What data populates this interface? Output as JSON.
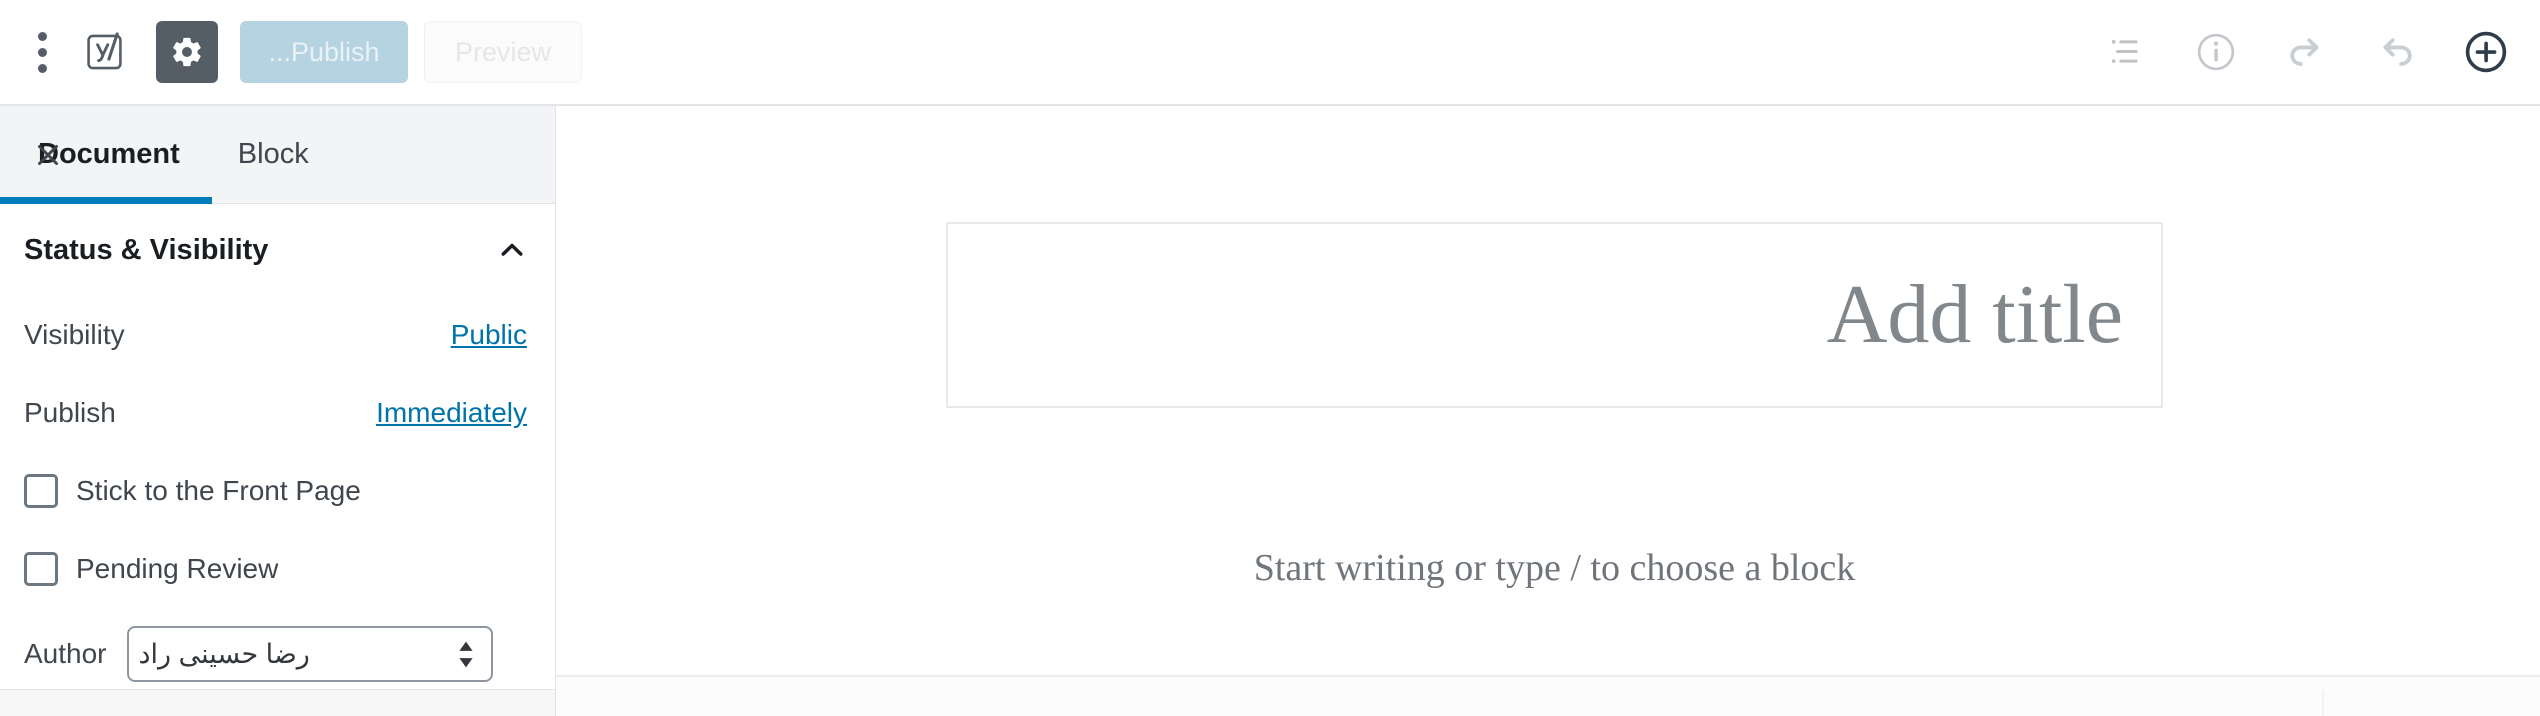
{
  "toolbar": {
    "menu_icon": "more-vertical-icon",
    "yoast_icon": "yoast-seo-logo-icon",
    "settings_icon": "gear-icon",
    "publish_label": "...Publish",
    "preview_label": "Preview",
    "list_view_icon": "list-view-icon",
    "info_icon": "info-icon",
    "redo_icon": "redo-icon",
    "undo_icon": "undo-icon",
    "add_block_icon": "add-block-icon"
  },
  "sidebar": {
    "close_icon": "close-icon",
    "tabs": [
      {
        "label": "Block",
        "active": false
      },
      {
        "label": "Document",
        "active": true
      }
    ],
    "panel": {
      "title": "Status & Visibility",
      "collapse_icon": "chevron-up-icon",
      "rows": [
        {
          "label": "Visibility",
          "value": "Public",
          "type": "link"
        },
        {
          "label": "Publish",
          "value": "Immediately",
          "type": "link"
        }
      ],
      "checkboxes": [
        {
          "label": "Stick to the Front Page",
          "checked": false
        },
        {
          "label": "Pending Review",
          "checked": false
        }
      ],
      "author": {
        "label": "Author",
        "value": "رضا حسینی راد",
        "spinner_icon": "updown-arrows-icon"
      }
    }
  },
  "editor": {
    "title_placeholder": "Add title",
    "block_placeholder": "Start writing or type / to choose a block"
  },
  "colors": {
    "accent_blue": "#007cba",
    "link_blue": "#0073aa",
    "gear_bg": "#555d66",
    "publish_bg": "#b5d3e0",
    "border": "#e2e4e7",
    "tab_bg": "#f3f4f5"
  }
}
